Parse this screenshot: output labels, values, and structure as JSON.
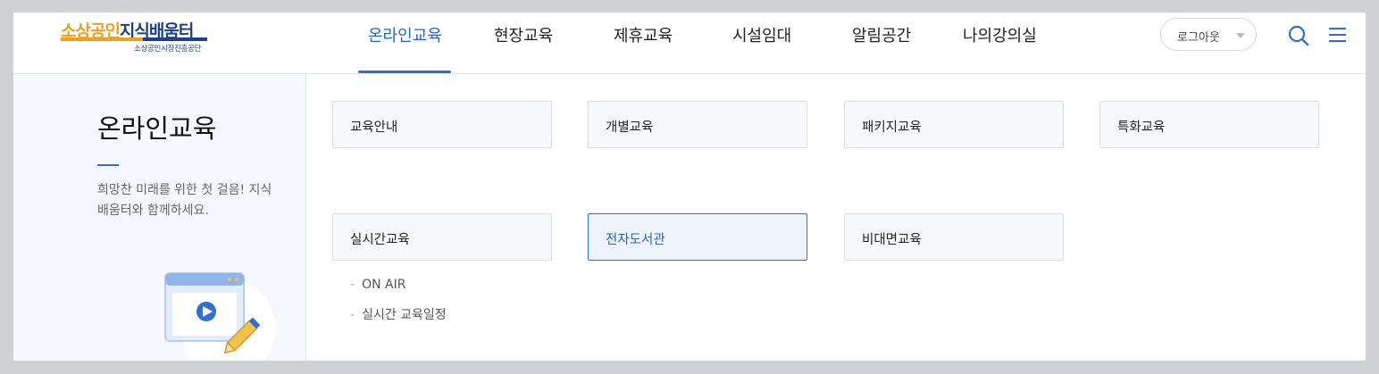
{
  "header": {
    "logo": {
      "part_a": "소상공인",
      "part_b": "지식배움터",
      "sub": "소상공인시장진흥공단"
    },
    "nav": [
      {
        "label": "온라인교육",
        "active": true
      },
      {
        "label": "현장교육"
      },
      {
        "label": "제휴교육"
      },
      {
        "label": "시설임대"
      },
      {
        "label": "알림공간"
      },
      {
        "label": "나의강의실"
      }
    ],
    "logout_label": "로그아웃",
    "icons": [
      "search-icon",
      "menu-icon"
    ]
  },
  "side": {
    "title": "온라인교육",
    "description": "희망찬 미래를 위한 첫 걸음! 지식배움터와 함께하세요."
  },
  "menu": {
    "cards": [
      {
        "label": "교육안내"
      },
      {
        "label": "개별교육"
      },
      {
        "label": "패키지교육"
      },
      {
        "label": "특화교육"
      },
      {
        "label": "실시간교육"
      },
      {
        "label": "전자도서관",
        "active": true
      },
      {
        "label": "비대면교육"
      }
    ],
    "realtime_sub": [
      "ON AIR",
      "실시간 교육일정"
    ]
  },
  "colors": {
    "accent": "#2f6fd4",
    "brand_orange": "#f0a01a",
    "brand_navy": "#1d3f8f"
  }
}
